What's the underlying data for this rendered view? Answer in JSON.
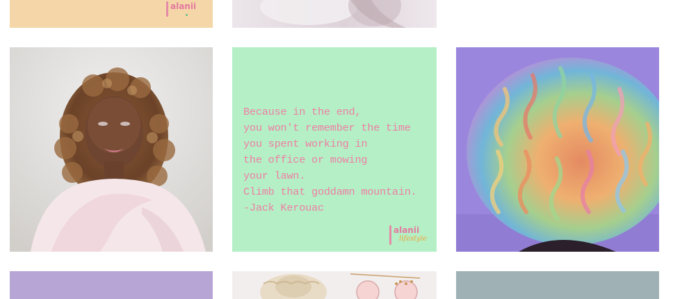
{
  "grid": {
    "tiles": [
      {
        "id": "top-left",
        "kind": "logo-card",
        "background": "#f4d6a8"
      },
      {
        "id": "top-middle",
        "kind": "photo"
      },
      {
        "id": "top-right",
        "kind": "photo",
        "background": "#ffffff"
      },
      {
        "id": "portrait",
        "kind": "photo"
      },
      {
        "id": "quote",
        "kind": "quote-card",
        "background": "#b4efc6"
      },
      {
        "id": "rainbow-hair",
        "kind": "photo",
        "background": "#9a86dd"
      },
      {
        "id": "bottom-left",
        "kind": "photo",
        "background": "#b7a5d6"
      },
      {
        "id": "bottom-middle",
        "kind": "photo"
      },
      {
        "id": "bottom-right",
        "kind": "photo",
        "background": "#9fb1b4"
      }
    ]
  },
  "logo": {
    "word": "alanii",
    "tagline": "lifestyle"
  },
  "quote": {
    "text": "Because in the end,\nyou won't remember the time\nyou spent working in\nthe office or mowing\nyour lawn.\nClimb that goddamn mountain.\n-Jack Kerouac",
    "color": "#ef7fa3"
  }
}
